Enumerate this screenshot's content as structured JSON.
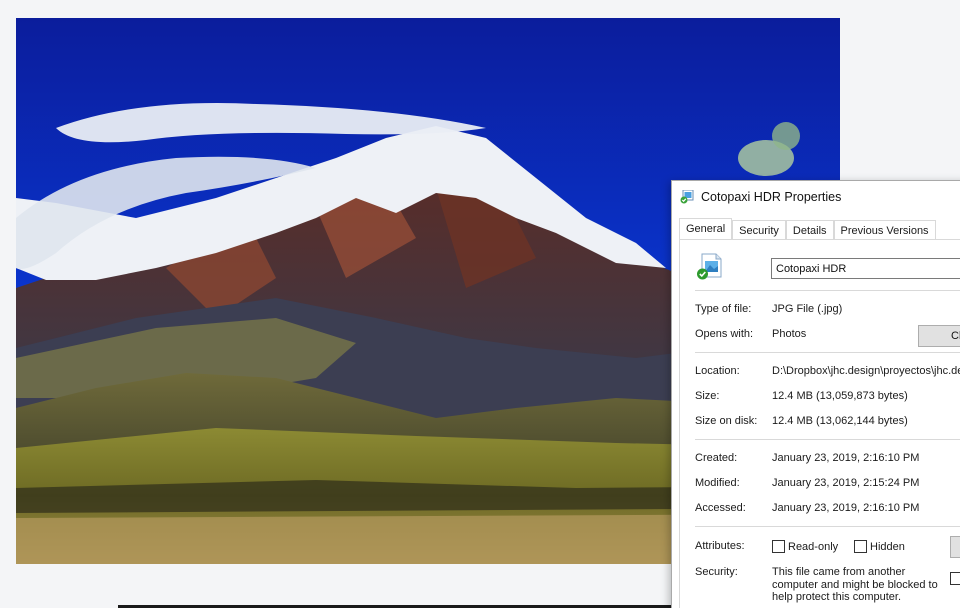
{
  "dialog": {
    "title": "Cotopaxi HDR Properties",
    "tabs": [
      "General",
      "Security",
      "Details",
      "Previous Versions"
    ],
    "file_name": "Cotopaxi HDR",
    "type_label": "Type of file:",
    "type_value": "JPG File (.jpg)",
    "opens_label": "Opens with:",
    "opens_value": "Photos",
    "change_button": "Ch",
    "location_label": "Location:",
    "location_value": "D:\\Dropbox\\jhc.design\\proyectos\\jhc.des",
    "size_label": "Size:",
    "size_value": "12.4 MB (13,059,873 bytes)",
    "size_disk_label": "Size on disk:",
    "size_disk_value": "12.4 MB (13,062,144 bytes)",
    "created_label": "Created:",
    "created_value": "January 23, 2019, 2:16:10 PM",
    "modified_label": "Modified:",
    "modified_value": "January 23, 2019, 2:15:24 PM",
    "accessed_label": "Accessed:",
    "accessed_value": "January 23, 2019, 2:16:10 PM",
    "attributes_label": "Attributes:",
    "readonly_label": "Read-only",
    "hidden_label": "Hidden",
    "security_label": "Security:",
    "security_text": "This file came from another computer and might be blocked to help protect this computer."
  },
  "colors": {
    "sky": "#0a2fb8",
    "snow": "#f2f4f8",
    "rock": "#7a3d2c",
    "grass": "#9a9a3a",
    "button_face": "#e1e1e1"
  }
}
